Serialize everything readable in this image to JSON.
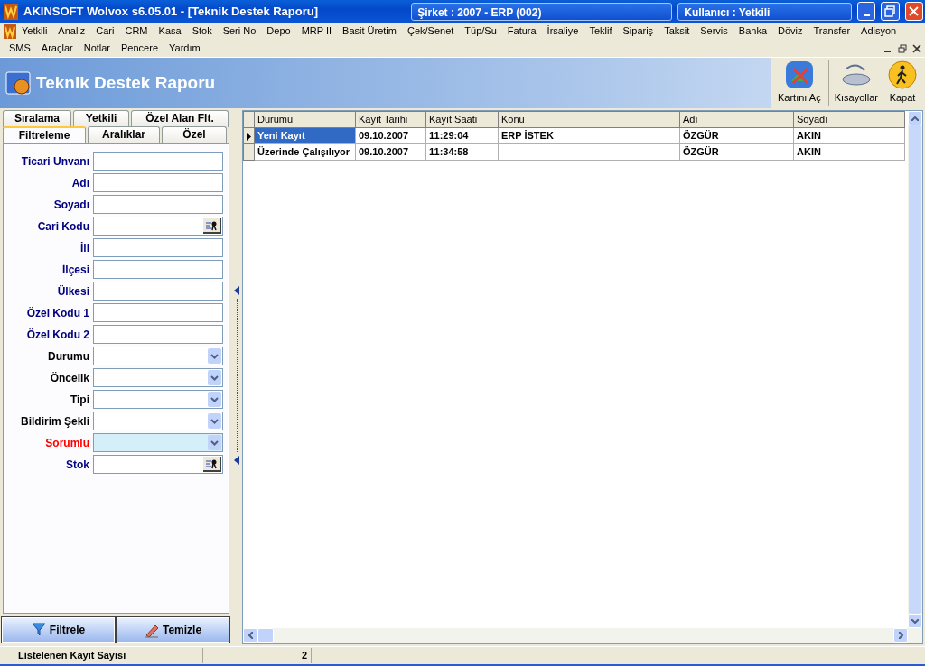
{
  "window": {
    "title": "AKINSOFT Wolvox s6.05.01 - [Teknik Destek Raporu]",
    "company": "Şirket : 2007 - ERP (002)",
    "user": "Kullanıcı : Yetkili"
  },
  "menu": [
    [
      "Yetkili",
      "Analiz",
      "Cari",
      "CRM",
      "Kasa",
      "Stok",
      "Seri No",
      "Depo",
      "MRP II",
      "Basit Üretim",
      "Çek/Senet",
      "Tüp/Su",
      "Fatura",
      "İrsaliye",
      "Teklif",
      "Sipariş",
      "Taksit",
      "Servis",
      "Banka",
      "Döviz",
      "Transfer",
      "Adisyon"
    ],
    [
      "SMS",
      "Araçlar",
      "Notlar",
      "Pencere",
      "Yardım"
    ]
  ],
  "header": {
    "title": "Teknik Destek Raporu",
    "tools": [
      {
        "label": "Kartını Aç",
        "kind": "open"
      },
      {
        "label": "Kısayollar",
        "kind": "shortcuts"
      },
      {
        "label": "Kapat",
        "kind": "exit"
      }
    ]
  },
  "filter_panel": {
    "tab_rows": [
      [
        {
          "label": "Sıralama",
          "selected": false
        },
        {
          "label": "Yetkili",
          "selected": false
        },
        {
          "label": "Özel Alan Flt.",
          "selected": false
        }
      ],
      [
        {
          "label": "Filtreleme",
          "selected": true
        },
        {
          "label": "Aralıklar",
          "selected": false
        },
        {
          "label": "Özel",
          "selected": false
        }
      ]
    ],
    "fields": [
      {
        "label": "Ticari Unvanı",
        "kind": "text",
        "color": "#000080",
        "highlighted": false
      },
      {
        "label": "Adı",
        "kind": "text",
        "color": "#000080",
        "highlighted": false
      },
      {
        "label": "Soyadı",
        "kind": "text",
        "color": "#000080",
        "highlighted": false
      },
      {
        "label": "Cari Kodu",
        "kind": "picker",
        "color": "#000080",
        "highlighted": false
      },
      {
        "label": "İli",
        "kind": "text",
        "color": "#000080",
        "highlighted": false
      },
      {
        "label": "İlçesi",
        "kind": "text",
        "color": "#000080",
        "highlighted": false
      },
      {
        "label": "Ülkesi",
        "kind": "text",
        "color": "#000080",
        "highlighted": false
      },
      {
        "label": "Özel Kodu 1",
        "kind": "text",
        "color": "#000080",
        "highlighted": false
      },
      {
        "label": "Özel Kodu 2",
        "kind": "text",
        "color": "#000080",
        "highlighted": false
      },
      {
        "label": "Durumu",
        "kind": "dropdown",
        "color": "#000000",
        "highlighted": false
      },
      {
        "label": "Öncelik",
        "kind": "dropdown",
        "color": "#000000",
        "highlighted": false
      },
      {
        "label": "Tipi",
        "kind": "dropdown",
        "color": "#000000",
        "highlighted": false
      },
      {
        "label": "Bildirim Şekli",
        "kind": "dropdown",
        "color": "#000000",
        "highlighted": false
      },
      {
        "label": "Sorumlu",
        "kind": "dropdown",
        "color": "#ff0000",
        "highlighted": true
      },
      {
        "label": "Stok",
        "kind": "picker",
        "color": "#000080",
        "highlighted": false
      }
    ],
    "buttons": [
      {
        "label": "Filtrele",
        "kind": "filter"
      },
      {
        "label": "Temizle",
        "kind": "clear"
      }
    ]
  },
  "grid": {
    "columns": [
      "Durumu",
      "Kayıt Tarihi",
      "Kayıt Saati",
      "Konu",
      "Adı",
      "Soyadı"
    ],
    "rows": [
      {
        "cells": [
          "Yeni Kayıt",
          "09.10.2007",
          "11:29:04",
          "ERP İSTEK",
          "ÖZGÜR",
          "AKIN"
        ],
        "selected": true
      },
      {
        "cells": [
          "Üzerinde Çalışılıyor",
          "09.10.2007",
          "11:34:58",
          "",
          "ÖZGÜR",
          "AKIN"
        ],
        "selected": false
      }
    ]
  },
  "status_bar": {
    "label": "Listelenen Kayıt Sayısı",
    "count": "2"
  }
}
